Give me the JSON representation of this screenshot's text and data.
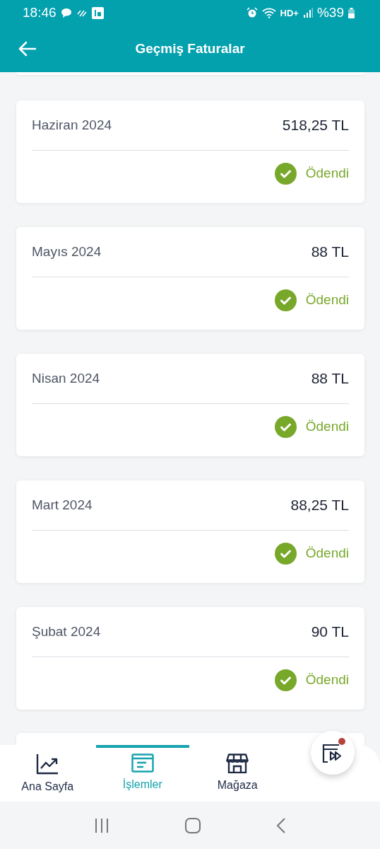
{
  "status_bar": {
    "time": "18:46",
    "hd_label": "HD+",
    "battery": "%39"
  },
  "header": {
    "title": "Geçmiş Faturalar"
  },
  "invoices": [
    {
      "period": "Haziran 2024",
      "amount": "518,25 TL",
      "status": "Ödendi",
      "kind": "paid"
    },
    {
      "period": "Mayıs 2024",
      "amount": "88 TL",
      "status": "Ödendi",
      "kind": "paid"
    },
    {
      "period": "Nisan 2024",
      "amount": "88 TL",
      "status": "Ödendi",
      "kind": "paid"
    },
    {
      "period": "Mart 2024",
      "amount": "88,25 TL",
      "status": "Ödendi",
      "kind": "paid"
    },
    {
      "period": "Şubat 2024",
      "amount": "90 TL",
      "status": "Ödendi",
      "kind": "paid"
    }
  ],
  "bottom_nav": [
    {
      "label": "Ana Sayfa",
      "kind": "chart",
      "selected": false
    },
    {
      "label": "İşlemler",
      "kind": "list",
      "selected": true
    },
    {
      "label": "Mağaza",
      "kind": "store",
      "selected": false
    }
  ],
  "floating_button": {
    "has_notification": true
  }
}
